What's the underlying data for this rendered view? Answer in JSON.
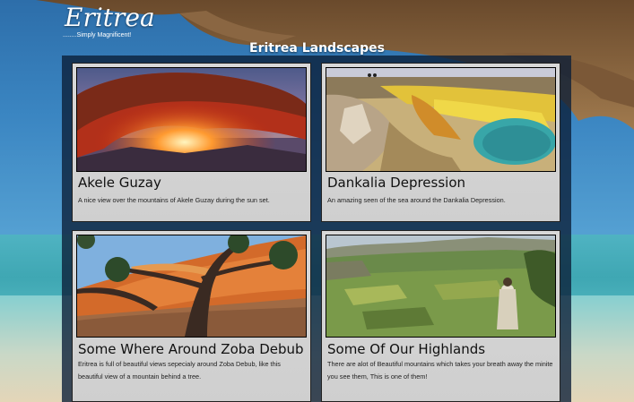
{
  "site": {
    "logo_title": "Eritrea",
    "logo_tagline": "........Simply Magnificent!",
    "page_title": "Eritrea Landscapes"
  },
  "gallery": {
    "items": [
      {
        "title": "Akele Guzay",
        "description": "A nice view over the mountains of Akele Guzay during the sun set."
      },
      {
        "title": "Dankalia Depression",
        "description": "An amazing seen of the sea around the Dankalia Depression."
      },
      {
        "title": "Some Where Around Zoba Debub",
        "description": "Eritrea is full of beautiful views sepecialy around Zoba Debub, like this beautiful view of a mountain behind a tree."
      },
      {
        "title": "Some Of Our Highlands",
        "description": "There are alot of Beautiful mountains which takes your breath away the minite you see them, This is one of them!"
      }
    ]
  },
  "colors": {
    "gallery_bg": "#0a1e37",
    "card_bg": "#d4d4d4",
    "title_text": "#ffffff"
  }
}
